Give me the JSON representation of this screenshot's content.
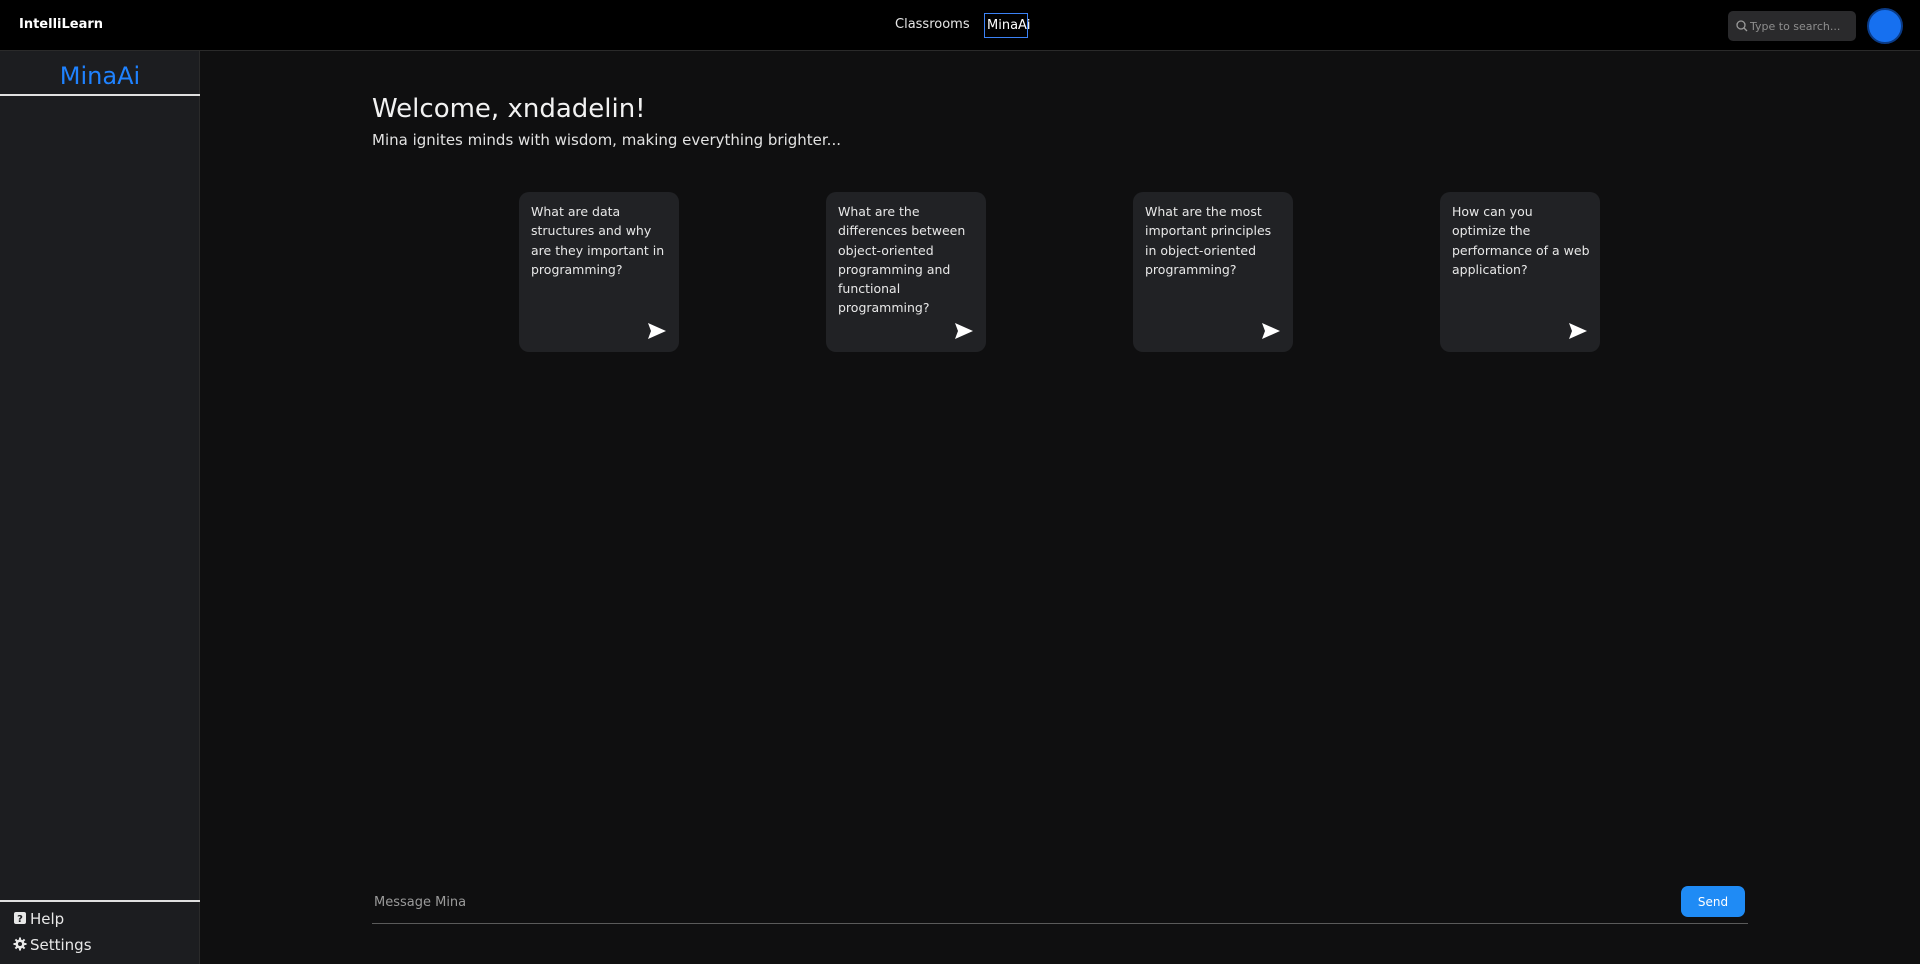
{
  "app": {
    "brand": "IntelliLearn"
  },
  "nav": {
    "classrooms_label": "Classrooms",
    "minaai_label": "MinaAi"
  },
  "search": {
    "placeholder": "Type to search..."
  },
  "sidebar": {
    "title": "MinaAi",
    "help_label": "Help",
    "settings_label": "Settings"
  },
  "main": {
    "welcome": "Welcome, xndadelin!",
    "tagline": "Mina ignites minds with wisdom, making everything brighter...",
    "suggestions": [
      {
        "text": "What are data structures and why are they important in programming?"
      },
      {
        "text": "What are the differences between object-oriented programming and functional programming?"
      },
      {
        "text": "What are the most important principles in object-oriented programming?"
      },
      {
        "text": "How can you optimize the performance of a web application?"
      }
    ]
  },
  "composer": {
    "placeholder": "Message Mina",
    "send_label": "Send"
  },
  "colors": {
    "accent": "#1f82ff",
    "send_button": "#1f8bf5",
    "avatar": "#1670f0"
  },
  "icons": [
    "search-icon",
    "send-icon",
    "help-icon",
    "gear-icon"
  ]
}
